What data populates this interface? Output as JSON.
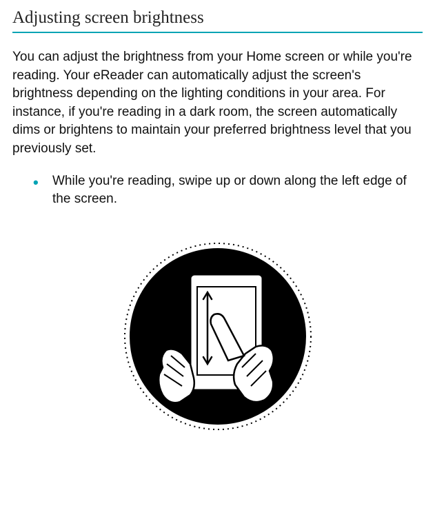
{
  "section": {
    "title": "Adjusting screen brightness",
    "intro": "You can adjust the brightness from your Home screen or while you're reading. Your eReader can automatically adjust the screen's brightness depending on the lighting conditions in your area. For instance, if you're reading in a dark room, the screen automatically dims or brightens to maintain your preferred brightness level that you previously set."
  },
  "bullets": [
    "While you're reading, swipe up or down along the left edge of the screen."
  ],
  "colors": {
    "accent": "#00a3b4"
  }
}
